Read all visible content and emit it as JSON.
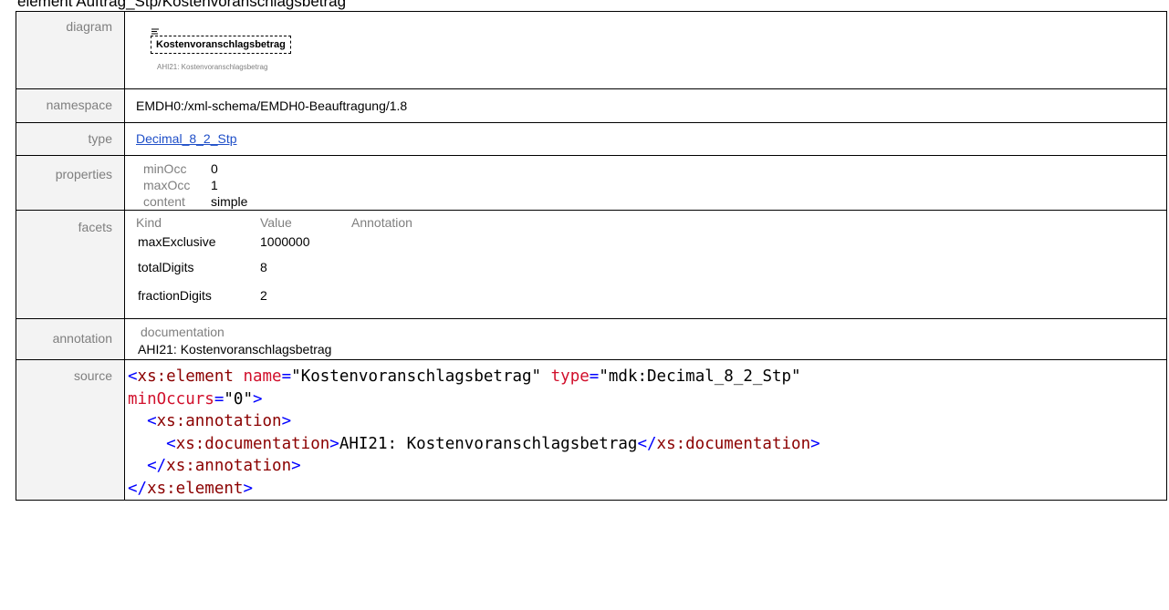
{
  "heading": "element Auftrag_Stp/Kostenvoranschlagsbetrag",
  "labels": {
    "diagram": "diagram",
    "namespace": "namespace",
    "type": "type",
    "properties": "properties",
    "facets": "facets",
    "annotation": "annotation",
    "source": "source"
  },
  "diagram": {
    "element_name": "Kostenvoranschlagsbetrag",
    "caption": "AHI21: Kostenvoranschlagsbetrag",
    "icon": "documentation-lines-icon"
  },
  "namespace": "EMDH0:/xml-schema/EMDH0-Beauftragung/1.8",
  "type": "Decimal_8_2_Stp",
  "properties": [
    {
      "key": "minOcc",
      "value": "0"
    },
    {
      "key": "maxOcc",
      "value": "1"
    },
    {
      "key": "content",
      "value": "simple"
    }
  ],
  "facets": {
    "headers": [
      "Kind",
      "Value",
      "Annotation"
    ],
    "rows": [
      {
        "kind": "maxExclusive",
        "value": "1000000",
        "annotation": ""
      },
      {
        "kind": "totalDigits",
        "value": "8",
        "annotation": ""
      },
      {
        "kind": "fractionDigits",
        "value": "2",
        "annotation": ""
      }
    ]
  },
  "annotation": {
    "key": "documentation",
    "value": "AHI21: Kostenvoranschlagsbetrag"
  },
  "source": {
    "open_bracket": "<",
    "close_bracket": ">",
    "end_open": "</",
    "xs_element": "xs:element",
    "xs_annotation": "xs:annotation",
    "xs_documentation": "xs:documentation",
    "attr_name": "name",
    "attr_name_val": "\"Kostenvoranschlagsbetrag\"",
    "attr_type": "type",
    "attr_type_val": "\"mdk:Decimal_8_2_Stp\"",
    "attr_min": "minOccurs",
    "attr_min_val": "\"0\"",
    "eq": "=",
    "doc_text": "AHI21: Kostenvoranschlagsbetrag"
  },
  "colors": {
    "label_bg": "#f3f3f3",
    "label_text": "#7f7f7f",
    "link": "#1f4fc8",
    "xml_bracket": "#0000ff",
    "xml_tag": "#8b0000",
    "xml_attr": "#d1102c"
  }
}
